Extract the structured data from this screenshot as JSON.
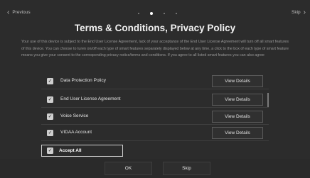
{
  "nav": {
    "previous_label": "Previous",
    "skip_label": "Skip",
    "page_dots": 4,
    "active_dot": 1
  },
  "title": "Terms & Conditions, Privacy Policy",
  "description": "Your use of this device is subject to the End User License Agreement, lack of your acceptance of the End User License Agreement will turn off all smart features of this device. You can choose to turen on/off each type of smart features separately displayed below at any time, a click to the box of each type of smart feature means you give your consent to the corresponding privacy notice/terms and conditions. If you agree to all listed smart features you can also agree",
  "items": [
    {
      "label": "Data Protection Policy",
      "checked": true,
      "details_label": "View Details"
    },
    {
      "label": "End User License Agreement",
      "checked": true,
      "details_label": "View Details"
    },
    {
      "label": "Voice Service",
      "checked": true,
      "details_label": "View Details"
    },
    {
      "label": "VIDAA Account",
      "checked": true,
      "details_label": "View Details"
    }
  ],
  "accept_all": {
    "label": "Accept All",
    "checked": true
  },
  "buttons": {
    "ok_label": "OK",
    "skip_label": "Skip"
  },
  "colors": {
    "background": "#2c2c2c",
    "text": "#e6e6e6",
    "muted": "#9a9a9a",
    "focus_border": "#cfcfcf"
  }
}
